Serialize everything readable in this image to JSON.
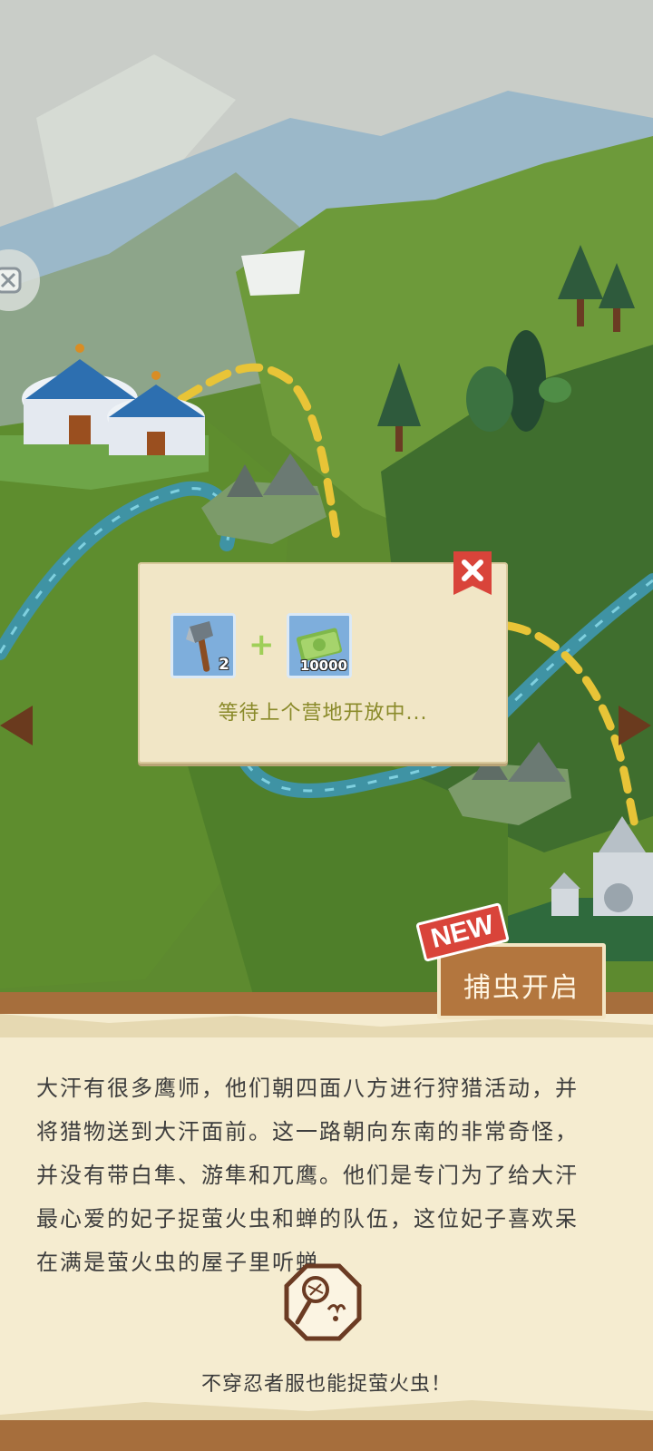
{
  "popup": {
    "items": [
      {
        "name": "axe",
        "count": "2"
      },
      {
        "name": "cash",
        "count": "10000"
      }
    ],
    "plus": "+",
    "status": "等待上个营地开放中...",
    "close_icon": "close-x-icon"
  },
  "feature": {
    "badge": "NEW",
    "label": "捕虫开启"
  },
  "story": {
    "text": "大汗有很多鹰师，他们朝四面八方进行狩猎活动，并\n将猎物送到大汗面前。这一路朝向东南的非常奇怪，\n并没有带白隼、游隼和兀鹰。他们是专门为了给大汗\n最心爱的妃子捉萤火虫和蝉的队伍，这位妃子喜欢呆\n在满是萤火虫的屋子里听蝉。",
    "hint": "不穿忍者服也能捉萤火虫！",
    "icon": "bug-net-icon"
  },
  "colors": {
    "sky": "#c9cdc8",
    "grass": "#5d8a2f",
    "path": "#e8c437",
    "river": "#4aa7b8",
    "panel": "#f5ecd0",
    "close_red": "#d9443a"
  }
}
